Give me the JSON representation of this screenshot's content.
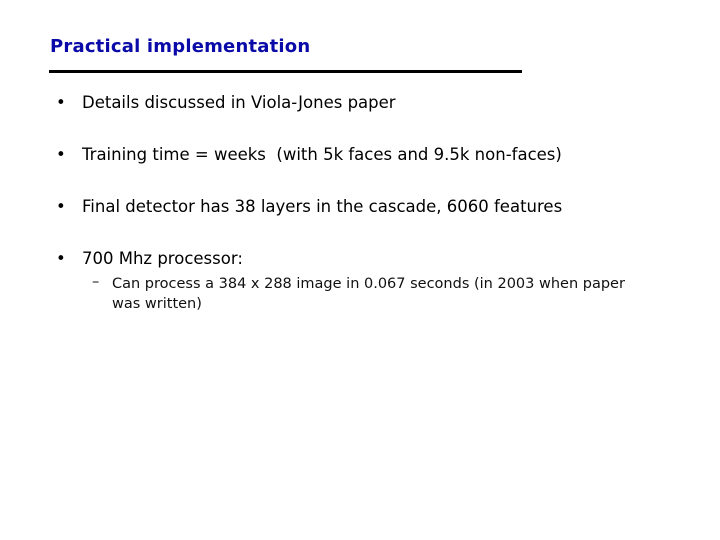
{
  "slide": {
    "title": "Practical implementation",
    "bullets": [
      {
        "text": "Details discussed in Viola-Jones paper"
      },
      {
        "text": "Training time = weeks  (with 5k faces and 9.5k non-faces)"
      },
      {
        "text": "Final detector has 38 layers in the cascade, 6060 features"
      },
      {
        "text": "700 Mhz processor:"
      }
    ],
    "bullet_symbol": "•",
    "sub_bullet_symbol": "–",
    "sub_bullets": [
      {
        "text": "Can process a 384 x 288 image in 0.067 seconds (in 2003 when paper was written)"
      }
    ]
  }
}
